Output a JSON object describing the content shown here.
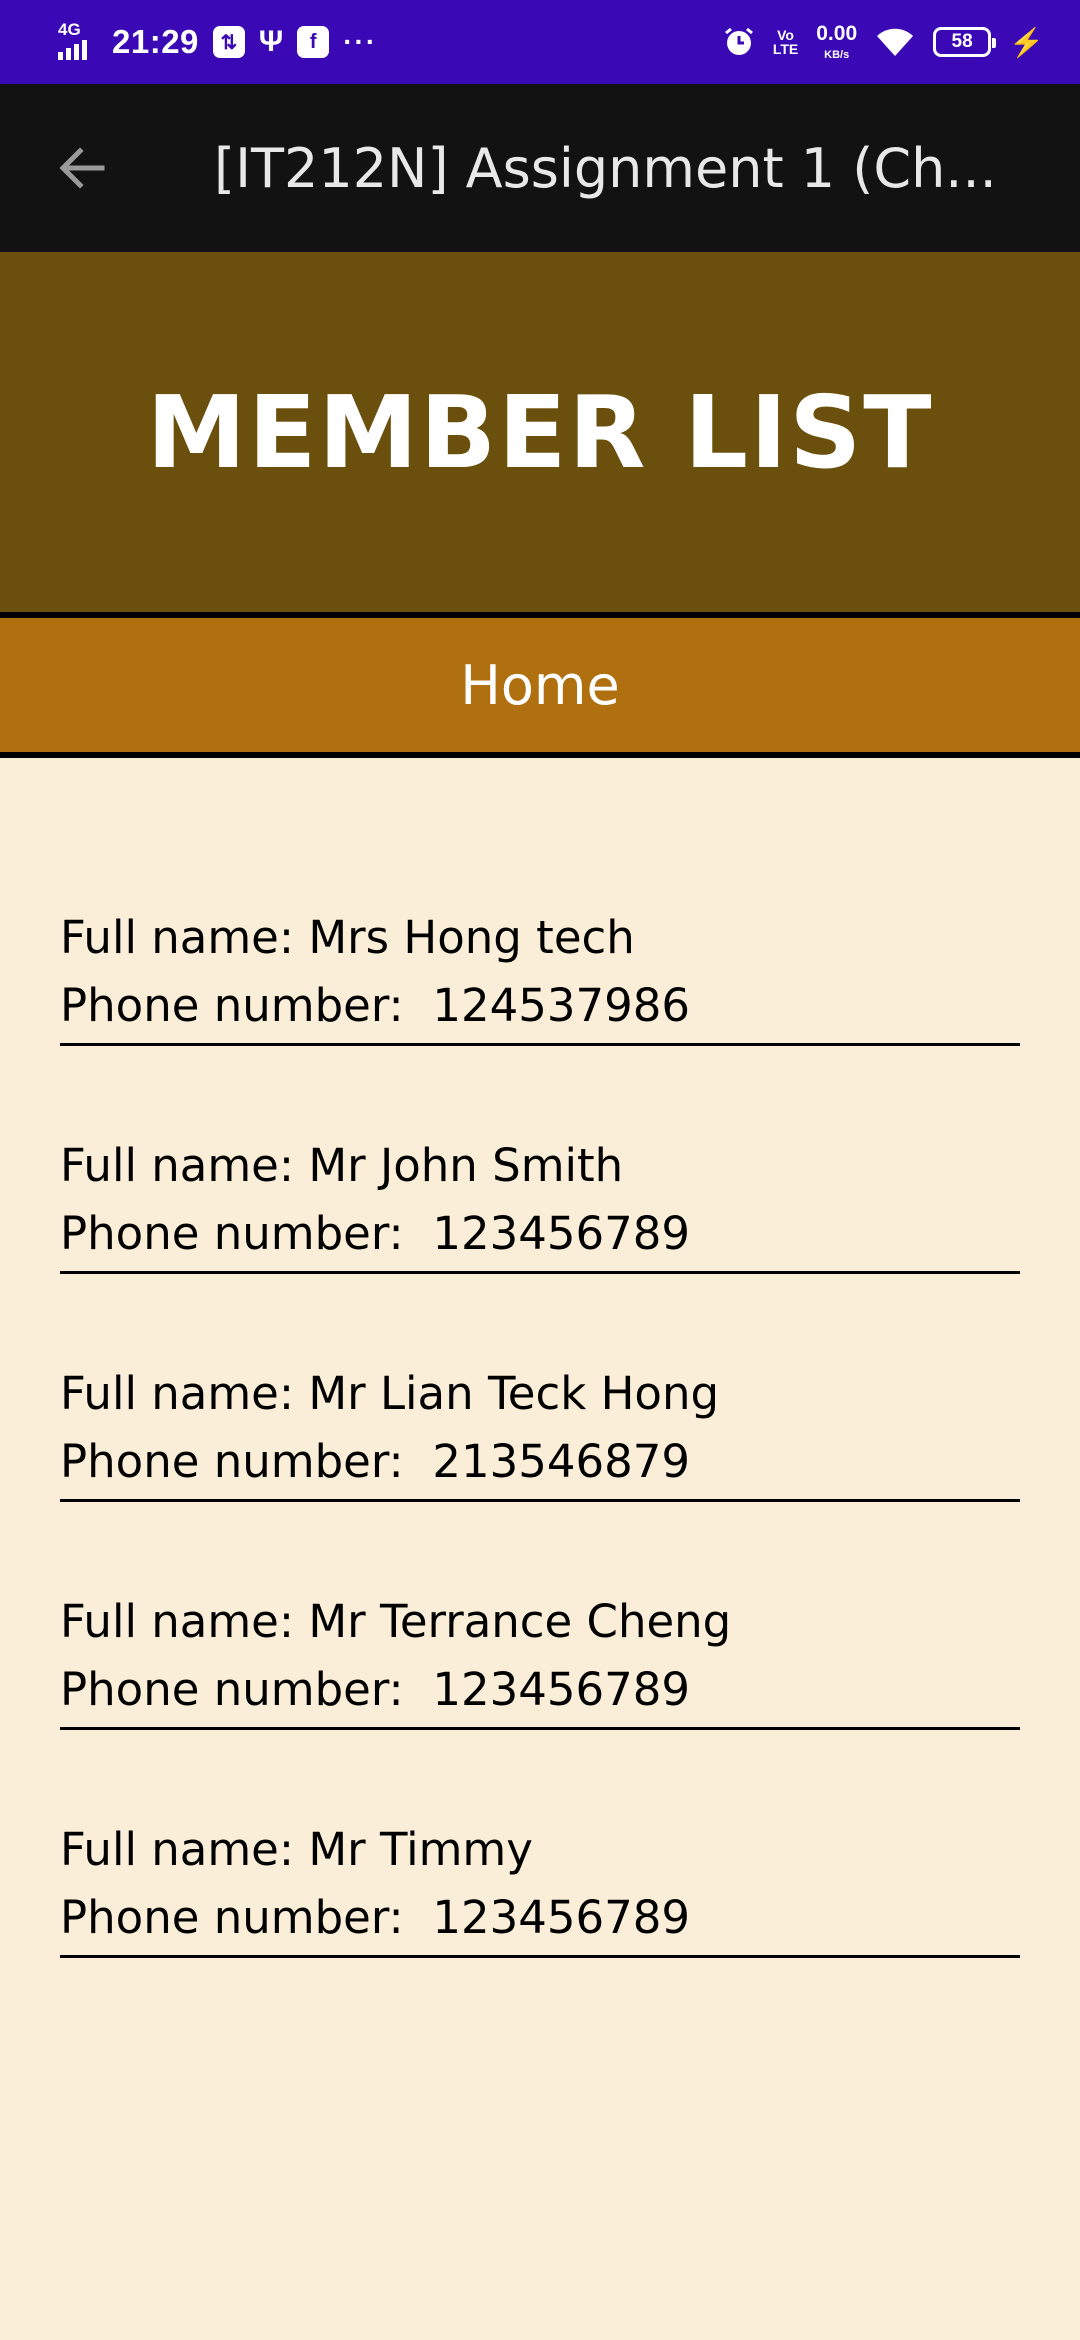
{
  "status_bar": {
    "network": "4G",
    "time": "21:29",
    "speed_value": "0.00",
    "speed_unit": "KB/s",
    "volte_top": "Vo",
    "volte_bottom": "LTE",
    "battery": "58",
    "icons": [
      "signal-icon",
      "data-saver-icon",
      "usb-icon",
      "facebook-icon",
      "more-icon",
      "alarm-icon",
      "volte-icon",
      "wifi-icon",
      "battery-icon",
      "charging-icon"
    ]
  },
  "app_bar": {
    "title": "[IT212N] Assignment 1 (Ch...",
    "back_icon": "arrow-back-icon"
  },
  "banner": {
    "title": "MEMBER LIST"
  },
  "nav": {
    "home_label": "Home"
  },
  "labels": {
    "full_name": "Full name: ",
    "phone_number": "Phone number:  "
  },
  "members": [
    {
      "name": "Mrs Hong tech",
      "phone": "124537986"
    },
    {
      "name": "Mr John Smith",
      "phone": "123456789"
    },
    {
      "name": "Mr Lian Teck Hong",
      "phone": "213546879"
    },
    {
      "name": "Mr Terrance Cheng",
      "phone": "123456789"
    },
    {
      "name": "Mr Timmy",
      "phone": "123456789"
    }
  ],
  "colors": {
    "status_bar": "#3a08b5",
    "app_bar": "#121212",
    "banner": "#6a500c",
    "nav": "#b07010",
    "page_bg": "#faeed8"
  }
}
